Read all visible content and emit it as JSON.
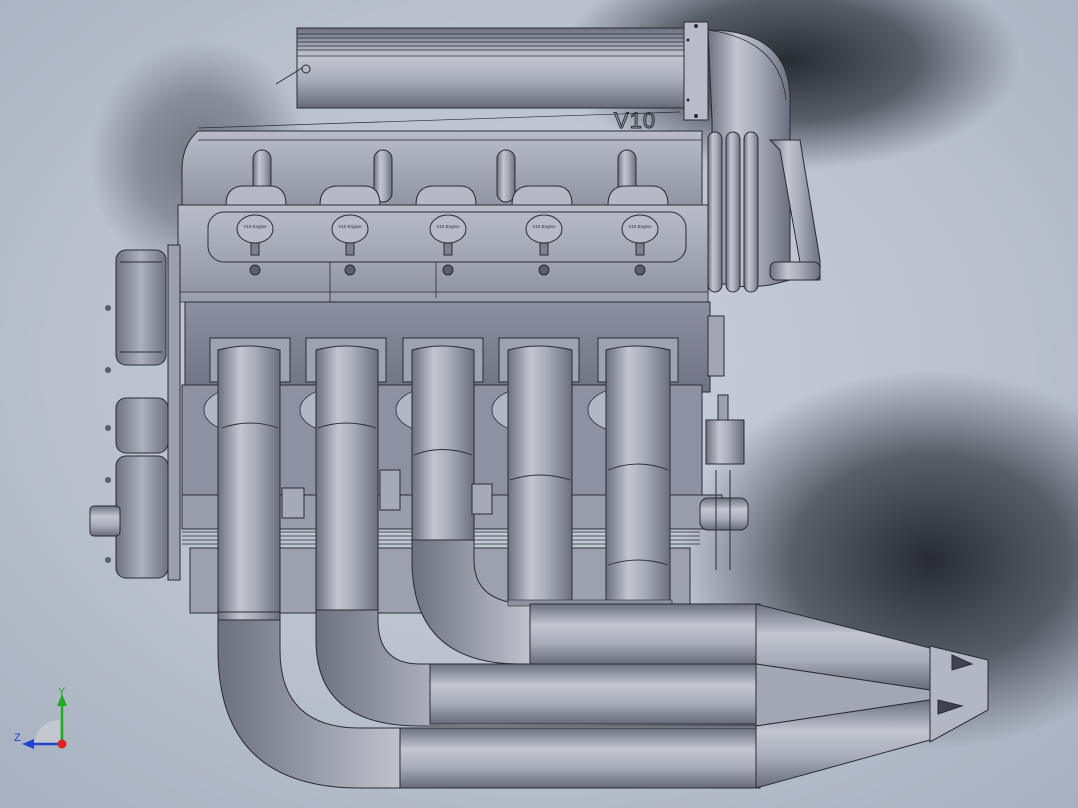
{
  "model": {
    "engine_badge": "V10",
    "cap_labels": [
      "V10 Engine",
      "V10 Engine",
      "V10 Engine",
      "V10 Engine",
      "V10 Engine"
    ]
  },
  "triad": {
    "y_label": "Y",
    "z_label": "Z"
  },
  "colors": {
    "background_light": "#dfe5ec",
    "background_mid": "#b4bccb",
    "shadow": "#2f343c",
    "metal_light": "#c9ccd6",
    "metal_mid": "#9ea2b1",
    "metal_dark": "#6e7283",
    "edge": "#2a2c34",
    "axis_y": "#22aa22",
    "axis_z": "#2244cc",
    "axis_x": "#dd2222"
  }
}
